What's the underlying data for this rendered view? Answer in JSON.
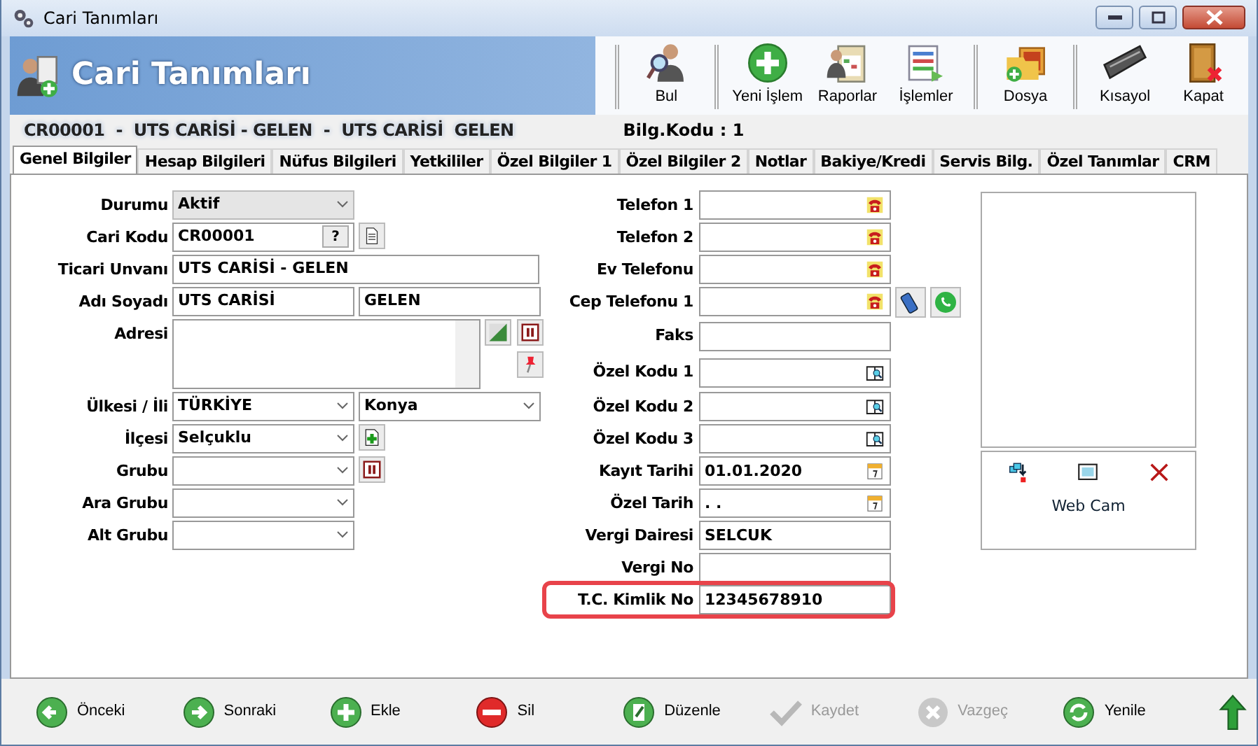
{
  "window": {
    "title": "Cari Tanımları"
  },
  "header": {
    "title": "Cari Tanımları"
  },
  "toolbar": [
    {
      "label": "Bul",
      "kind": "find",
      "group_start": true
    },
    {
      "label": "Yeni İşlem",
      "kind": "new",
      "group_start": true
    },
    {
      "label": "Raporlar",
      "kind": "report",
      "group_start": false
    },
    {
      "label": "İşlemler",
      "kind": "list",
      "group_start": false
    },
    {
      "label": "Dosya",
      "kind": "file",
      "group_start": true
    },
    {
      "label": "Kısayol",
      "kind": "keyboard",
      "group_start": true
    },
    {
      "label": "Kapat",
      "kind": "door",
      "group_start": false
    }
  ],
  "record": {
    "parts": [
      "CR00001",
      "-",
      "UTS CARİSİ - GELEN",
      "-",
      "UTS CARİSİ",
      "GELEN"
    ],
    "info": "Bilg.Kodu : 1"
  },
  "tabs": [
    {
      "label": "Genel Bilgiler",
      "selected": true
    },
    {
      "label": "Hesap Bilgileri",
      "selected": false
    },
    {
      "label": "Nüfus Bilgileri",
      "selected": false
    },
    {
      "label": "Yetkililer",
      "selected": false
    },
    {
      "label": "Özel Bilgiler 1",
      "selected": false
    },
    {
      "label": "Özel Bilgiler 2",
      "selected": false
    },
    {
      "label": "Notlar",
      "selected": false
    },
    {
      "label": "Bakiye/Kredi",
      "selected": false
    },
    {
      "label": "Servis Bilg.",
      "selected": false
    },
    {
      "label": "Özel Tanımlar",
      "selected": false
    },
    {
      "label": "CRM",
      "selected": false
    }
  ],
  "left_fields": [
    {
      "label": "Durumu",
      "kind": "combo",
      "values": [
        "Aktif"
      ]
    },
    {
      "label": "Cari Kodu",
      "kind": "code",
      "values": [
        "CR00001"
      ],
      "button": "?",
      "side": [
        {
          "kind": "document"
        }
      ]
    },
    {
      "label": "Ticari Unvanı",
      "kind": "text",
      "values": [
        "UTS CARİSİ - GELEN"
      ]
    },
    {
      "label": "Adı Soyadı",
      "kind": "pair",
      "values": [
        "UTS CARİSİ",
        "GELEN"
      ]
    },
    {
      "label": "Adresi",
      "kind": "textarea",
      "side": [
        {
          "kind": "map"
        },
        {
          "kind": "pause"
        },
        {
          "kind": "pin"
        }
      ]
    },
    {
      "label": "Ülkesi / İli",
      "kind": "select-pair",
      "values": [
        "TÜRKİYE",
        "Konya"
      ]
    },
    {
      "label": "İlçesi",
      "kind": "select",
      "values": [
        "Selçuklu"
      ],
      "side": [
        {
          "kind": "add"
        }
      ]
    },
    {
      "label": "Grubu",
      "kind": "select",
      "side": [
        {
          "kind": "pause"
        }
      ]
    },
    {
      "label": "Ara Grubu",
      "kind": "select"
    },
    {
      "label": "Alt Grubu",
      "kind": "select"
    }
  ],
  "right_fields": [
    {
      "label": "Telefon 1",
      "kind": "phone",
      "highlighted": false
    },
    {
      "label": "Telefon 2",
      "kind": "phone",
      "highlighted": false
    },
    {
      "label": "Ev Telefonu",
      "kind": "phone",
      "highlighted": false
    },
    {
      "label": "Cep Telefonu 1",
      "kind": "phone",
      "highlighted": false,
      "extras": [
        {
          "kind": "mobile"
        },
        {
          "kind": "whatsapp"
        }
      ]
    },
    {
      "label": "Faks",
      "kind": "text",
      "highlighted": false
    },
    {
      "label": "Özel Kodu 1",
      "kind": "lookup",
      "highlighted": false
    },
    {
      "label": "Özel Kodu 2",
      "kind": "lookup",
      "highlighted": false
    },
    {
      "label": "Özel Kodu 3",
      "kind": "lookup",
      "highlighted": false
    },
    {
      "label": "Kayıt Tarihi",
      "kind": "date",
      "value": "01.01.2020",
      "highlighted": false
    },
    {
      "label": "Özel Tarih",
      "kind": "date",
      "value": " . .",
      "highlighted": false
    },
    {
      "label": "Vergi Dairesi",
      "kind": "text",
      "value": "SELCUK",
      "highlighted": false
    },
    {
      "label": "Vergi No",
      "kind": "text",
      "highlighted": false
    },
    {
      "label": "T.C. Kimlik No",
      "kind": "text",
      "value": "12345678910",
      "highlighted": true
    }
  ],
  "photo": {
    "caption": "Web Cam"
  },
  "nav_buttons": [
    {
      "label": "Önceki",
      "kind": "prev",
      "disabled": false
    },
    {
      "label": "Sonraki",
      "kind": "next",
      "disabled": false
    },
    {
      "label": "Ekle",
      "kind": "add",
      "disabled": false
    },
    {
      "label": "Sil",
      "kind": "delete",
      "disabled": false
    },
    {
      "label": "Düzenle",
      "kind": "edit",
      "disabled": false
    },
    {
      "label": "Kaydet",
      "kind": "save",
      "disabled": true
    },
    {
      "label": "Vazgeç",
      "kind": "cancel",
      "disabled": true
    },
    {
      "label": "Yenile",
      "kind": "refresh",
      "disabled": false
    }
  ]
}
